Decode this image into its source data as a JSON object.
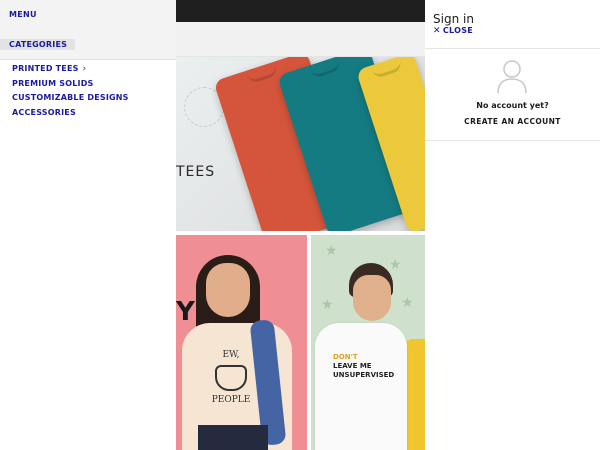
{
  "menu": {
    "title": "MENU",
    "categories_label": "CATEGORIES",
    "items": [
      {
        "label": "PRINTED TEES",
        "has_submenu": true
      },
      {
        "label": "PREMIUM SOLIDS",
        "has_submenu": false
      },
      {
        "label": "CUSTOMIZABLE DESIGNS",
        "has_submenu": false
      },
      {
        "label": "ACCESSORIES",
        "has_submenu": false
      }
    ],
    "chevron_icon": "chevron-right-icon",
    "text_color": "#1a1a9c"
  },
  "store": {
    "hero_text": "TEES",
    "tiles": {
      "left_partial_letter": "Y",
      "girl_tee_print_top": "EW,",
      "girl_tee_print_bottom": "PEOPLE",
      "boy_tee_print_highlight": "DON'T",
      "boy_tee_print_lines": [
        "LEAVE ME",
        "UNSUPERVISED"
      ]
    },
    "tee_colors": [
      "#d4553c",
      "#157b83",
      "#ecc93b"
    ]
  },
  "signin": {
    "title": "Sign in",
    "close_label": "CLOSE",
    "close_icon": "close-icon",
    "avatar_icon": "user-icon",
    "no_account_text": "No account yet?",
    "create_account_label": "CREATE AN ACCOUNT"
  }
}
